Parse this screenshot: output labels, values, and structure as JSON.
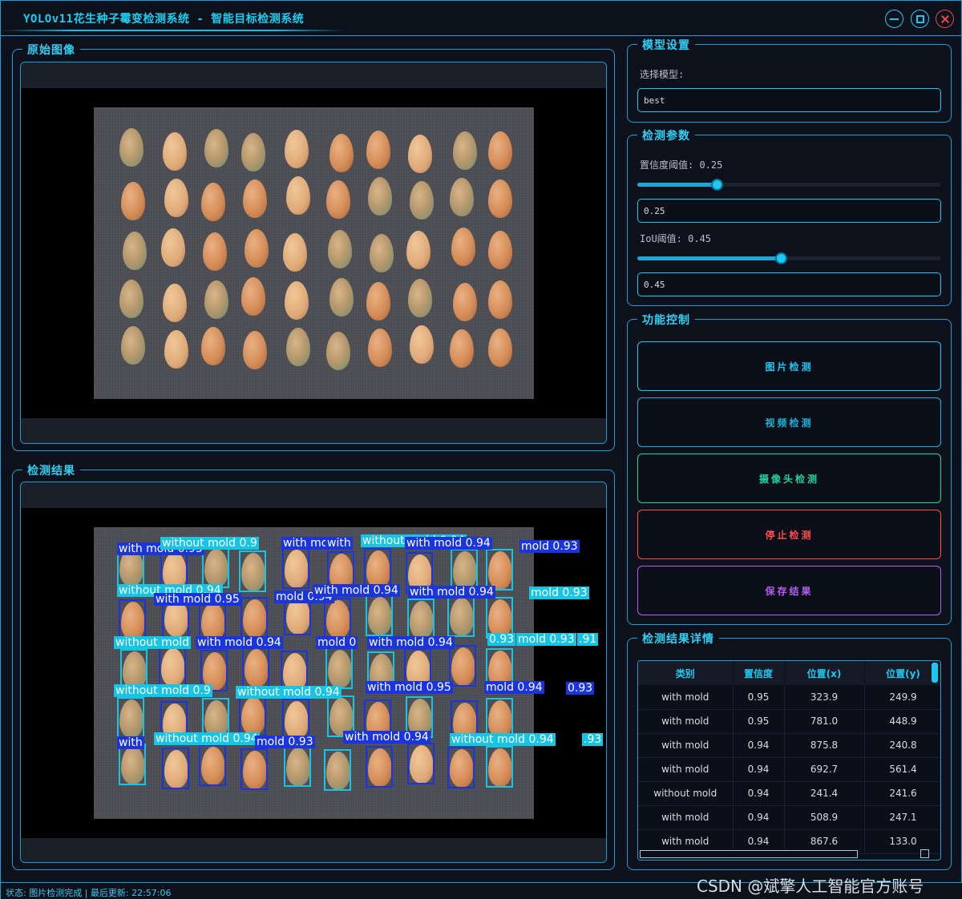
{
  "window": {
    "title": "YOLOv11花生种子霉变检测系统 - 智能目标检测系统",
    "accent_color": "#1ec8f0",
    "close_color": "#e84a4a",
    "icons": [
      "minimize-icon",
      "maximize-icon",
      "close-icon"
    ]
  },
  "original_image": {
    "title": "原始图像"
  },
  "detection_result": {
    "title": "检测结果",
    "labels": {
      "l1": "with mold 0.93",
      "l2": "without mold 0.9",
      "l3": "with mold",
      "l4": "with",
      "l5": "without mold 0.94",
      "l6": "with mold 0.94",
      "l7": "mold 0.93",
      "l8": "without mold 0.94",
      "l9": "with mold 0.95",
      "l10": "mold 0.94",
      "l11": "with mold 0.94",
      "l12": "with mold 0.94",
      "l13": "mold 0.93",
      "l14": "without mold",
      "l15": "with mold 0.94",
      "l16": "mold 0",
      "l17": "with mold 0.94",
      "l18": "0.93",
      "l19": "mold 0.93",
      "l20": ".91",
      "l21": "without mold 0.9",
      "l22": "without mold 0.94",
      "l23": "with mold 0.95",
      "l24": "mold 0.94",
      "l25": "0.93",
      "l26": "with",
      "l27": "without mold 0.94",
      "l28": "mold 0.93",
      "l29": "with mold 0.94",
      "l30": "without mold 0.94",
      "l31": ".93"
    }
  },
  "model_settings": {
    "title": "模型设置",
    "select_label": "选择模型:",
    "model_value": "best"
  },
  "detection_params": {
    "title": "检测参数",
    "confidence_label": "置信度阈值: 0.25",
    "confidence_value": "0.25",
    "confidence_level": 0.25,
    "iou_label": "IoU阈值: 0.45",
    "iou_value": "0.45",
    "iou_level": 0.45
  },
  "controls": {
    "title": "功能控制",
    "image_detect": "图片检测",
    "video_detect": "视频检测",
    "camera_detect": "摄像头检测",
    "stop_detect": "停止检测",
    "save_result": "保存结果",
    "colors": {
      "image": "#1ec8f0",
      "video": "#19b4d8",
      "camera": "#21d3a0",
      "stop": "#ff4e4e",
      "save": "#b45cf0"
    }
  },
  "results_table": {
    "title": "检测结果详情",
    "headers": [
      "类别",
      "置信度",
      "位置(x)",
      "位置(y)"
    ],
    "rows": [
      [
        "with mold",
        "0.95",
        "323.9",
        "249.9"
      ],
      [
        "with mold",
        "0.95",
        "781.0",
        "448.9"
      ],
      [
        "with mold",
        "0.94",
        "875.8",
        "240.8"
      ],
      [
        "with mold",
        "0.94",
        "692.7",
        "561.4"
      ],
      [
        "without mold",
        "0.94",
        "241.4",
        "241.6"
      ],
      [
        "with mold",
        "0.94",
        "508.9",
        "247.1"
      ],
      [
        "with mold",
        "0.94",
        "867.6",
        "133.0"
      ]
    ]
  },
  "status": {
    "text": "状态: 图片检测完成 | 最后更新: 22:57:06"
  },
  "watermark": "CSDN @斌擎人工智能官方账号"
}
